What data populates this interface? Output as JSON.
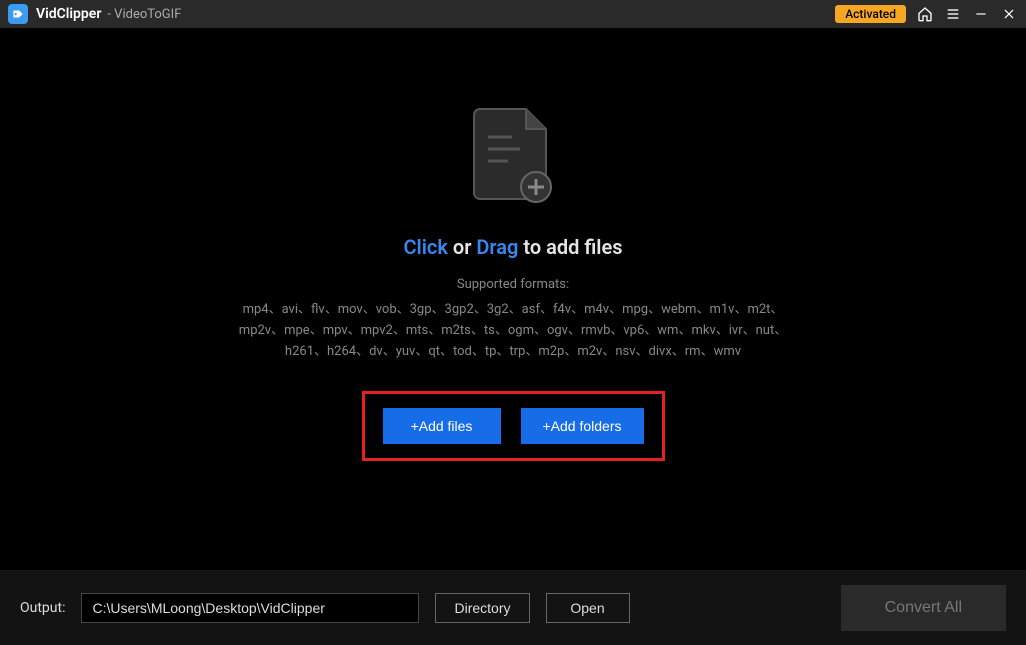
{
  "titlebar": {
    "appName": "VidClipper",
    "appSub": "- VideoToGIF",
    "activated": "Activated"
  },
  "main": {
    "promptClick": "Click",
    "promptOr": " or ",
    "promptDrag": "Drag",
    "promptAdd": " to add files",
    "supportedLabel": "Supported formats:",
    "formatsText": "mp4、avi、flv、mov、vob、3gp、3gp2、3g2、asf、f4v、m4v、mpg、webm、m1v、m2t、mp2v、mpe、mpv、mpv2、mts、m2ts、ts、ogm、ogv、rmvb、vp6、wm、mkv、ivr、nut、h261、h264、dv、yuv、qt、tod、tp、trp、m2p、m2v、nsv、divx、rm、wmv",
    "addFilesBtn": "+Add files",
    "addFoldersBtn": "+Add folders"
  },
  "footer": {
    "outputLabel": "Output:",
    "outputPath": "C:\\Users\\MLoong\\Desktop\\VidClipper",
    "directoryBtn": "Directory",
    "openBtn": "Open",
    "convertBtn": "Convert All"
  }
}
